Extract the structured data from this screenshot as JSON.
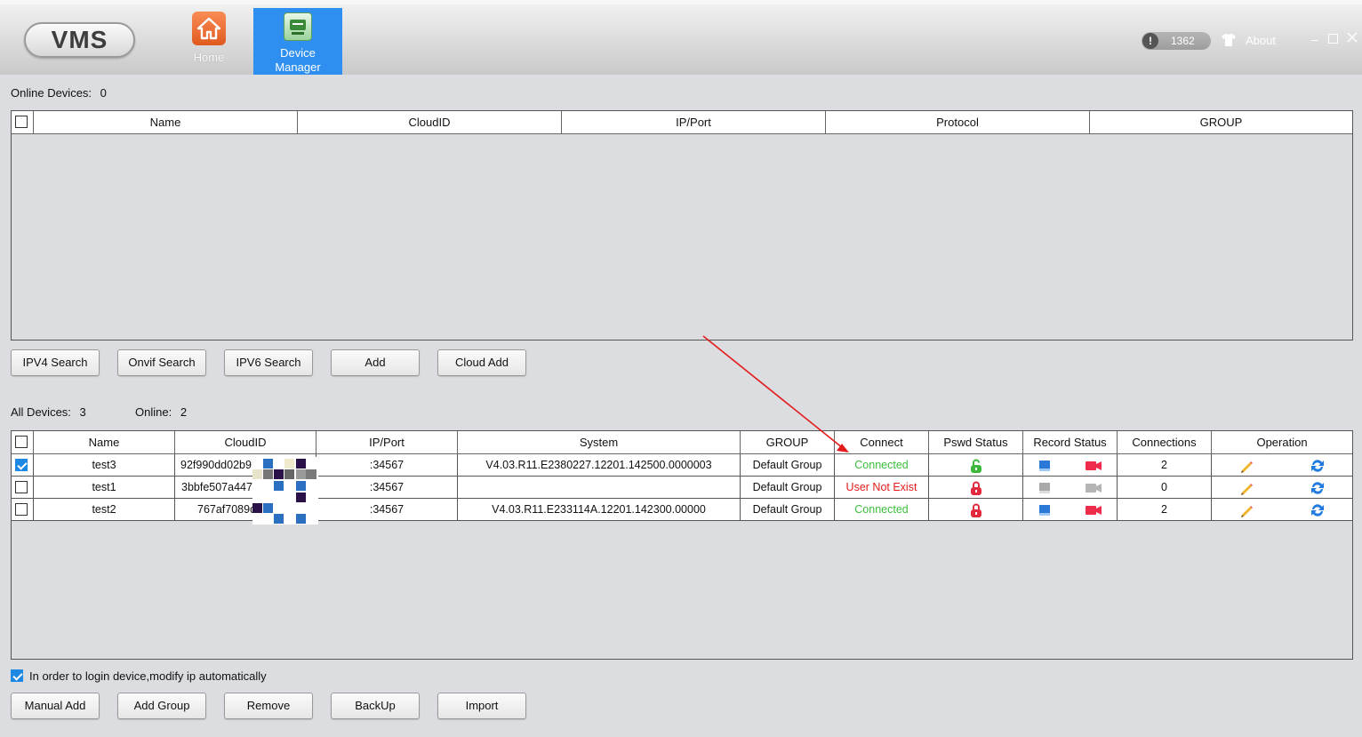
{
  "app": {
    "logo": "VMS",
    "nav": [
      {
        "label": "Home",
        "icon": "home-icon",
        "active": false
      },
      {
        "label": "Device\nManager",
        "icon": "device-manager-icon",
        "active": true
      }
    ],
    "notification_count": "1362",
    "about_label": "About",
    "accent": "#2f8ff0"
  },
  "online_section": {
    "label": "Online Devices:",
    "count": "0",
    "columns": [
      "Name",
      "CloudID",
      "IP/Port",
      "Protocol",
      "GROUP"
    ],
    "rows": []
  },
  "search_buttons": [
    "IPV4 Search",
    "Onvif Search",
    "IPV6 Search",
    "Add",
    "Cloud Add"
  ],
  "all_section": {
    "all_label": "All Devices:",
    "all_count": "3",
    "online_label": "Online:",
    "online_count": "2",
    "columns": [
      "Name",
      "CloudID",
      "IP/Port",
      "System",
      "GROUP",
      "Connect",
      "Pswd Status",
      "Record Status",
      "Connections",
      "Operation"
    ],
    "rows": [
      {
        "checked": true,
        "name": "test3",
        "cloudid": "92f990dd02b9",
        "ipport": ":34567",
        "system": "V4.03.R11.E2380227.12201.142500.0000003",
        "group": "Default Group",
        "connect": "Connected",
        "connect_status": "ok",
        "pswd": "unlocked",
        "record_active": true,
        "connections": "2"
      },
      {
        "checked": false,
        "name": "test1",
        "cloudid": "3bbfe507a447",
        "ipport": ":34567",
        "system": "",
        "group": "Default Group",
        "connect": "User Not Exist",
        "connect_status": "error",
        "pswd": "locked",
        "record_active": false,
        "connections": "0"
      },
      {
        "checked": false,
        "name": "test2",
        "cloudid": "767af7089d",
        "ipport": ":34567",
        "system": "V4.03.R11.E233114A.12201.142300.00000",
        "group": "Default Group",
        "connect": "Connected",
        "connect_status": "ok",
        "pswd": "locked",
        "record_active": true,
        "connections": "2"
      }
    ]
  },
  "auto_modify": {
    "checked": true,
    "label": "In order to login device,modify ip automatically"
  },
  "bottom_buttons": [
    "Manual Add",
    "Add Group",
    "Remove",
    "BackUp",
    "Import"
  ],
  "colors": {
    "connected": "#3cbf3c",
    "error": "#e31b1b",
    "annotation_arrow": "#e31b1b"
  }
}
